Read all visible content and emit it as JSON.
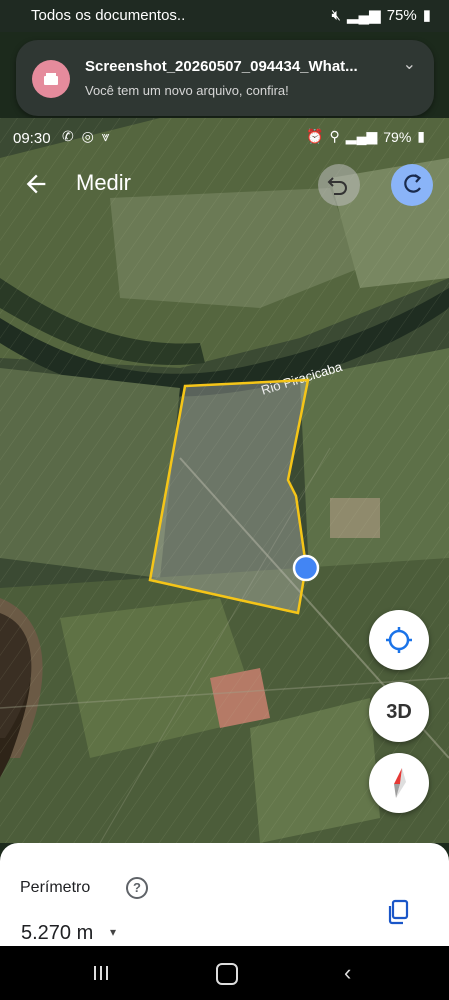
{
  "outer_status": {
    "left_text": "Todos os documentos..",
    "battery": "75%",
    "icons": [
      "mute-icon",
      "wifi-icon",
      "signal-icon",
      "battery-icon"
    ]
  },
  "notification": {
    "title": "Screenshot_20260507_094434_What...",
    "body": "Você tem um novo arquivo, confira!",
    "app_color": "#e58b9c"
  },
  "inner_status": {
    "time": "09:30",
    "battery": "79%",
    "left_icons": [
      "whatsapp-icon",
      "instagram-icon",
      "vpn-icon"
    ],
    "right_icons": [
      "alarm-icon",
      "mute-icon",
      "location-icon",
      "signal-4g-icon",
      "signal-icon"
    ]
  },
  "app_bar": {
    "title": "Medir",
    "accent": "#8ab4f8"
  },
  "map": {
    "river_label": "Rio Piracicaba",
    "polygon_color": "#f5c518",
    "location_dot_color": "#4285f4"
  },
  "controls": {
    "btn_3d_label": "3D"
  },
  "sheet": {
    "metric_label": "Perímetro",
    "value": "5.270 m",
    "unit_dropdown": "▾"
  }
}
